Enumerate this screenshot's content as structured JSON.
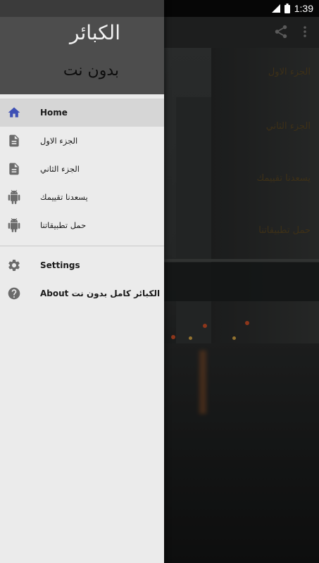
{
  "status_bar": {
    "time": "1:39"
  },
  "drawer": {
    "header": {
      "title": "الكبائر",
      "subtitle": "بدون نت"
    },
    "primary_items": [
      {
        "label": "Home",
        "icon": "home-icon",
        "selected": true
      },
      {
        "label": "الجزء الاول",
        "icon": "document-icon",
        "selected": false
      },
      {
        "label": "الجزء الثاني",
        "icon": "document-icon",
        "selected": false
      },
      {
        "label": "يسعدنا تقييمك",
        "icon": "android-icon",
        "selected": false
      },
      {
        "label": "حمل تطبيقاتنا",
        "icon": "android-icon",
        "selected": false
      }
    ],
    "secondary_items": [
      {
        "label": "Settings",
        "icon": "gear-icon"
      },
      {
        "label": "About الكبائر كامل بدون نت",
        "icon": "help-icon"
      }
    ]
  },
  "background_list": {
    "items": [
      "الجزء الاول",
      "الجزء الثاني",
      "يسعدنا تقييمك",
      "حمل تطبيقاتنا"
    ]
  },
  "colors": {
    "accent": "#3f51b5",
    "drawer_bg": "#ebebeb",
    "header_bg": "#4d4d4d",
    "selected_bg": "#d6d6d6"
  }
}
